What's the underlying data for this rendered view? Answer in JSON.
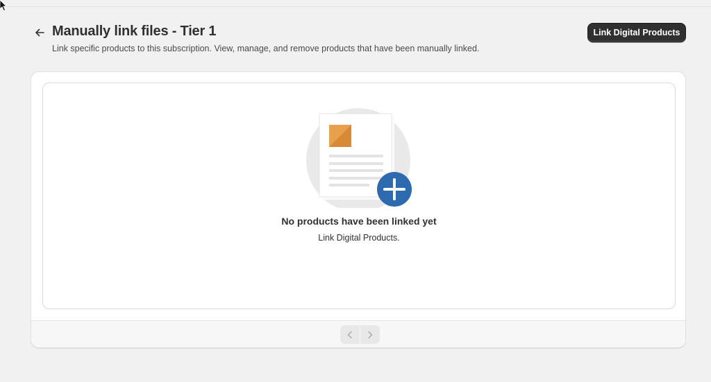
{
  "header": {
    "back_icon": "arrow-left-icon",
    "title": "Manually link files - Tier 1",
    "subtitle": "Link specific products to this subscription. View, manage, and remove products that have been manually linked.",
    "primary_action_label": "Link Digital Products"
  },
  "empty_state": {
    "illustration_icon": "document-add-illustration",
    "heading": "No products have been linked yet",
    "description": "Link Digital Products."
  },
  "pagination": {
    "prev_icon": "chevron-left-icon",
    "next_icon": "chevron-right-icon",
    "prev_enabled": false,
    "next_enabled": false
  },
  "colors": {
    "background": "#f1f1f1",
    "primary_button": "#303030",
    "illustration_orange": "#e8a04c",
    "illustration_blue": "#2e6ab0"
  }
}
